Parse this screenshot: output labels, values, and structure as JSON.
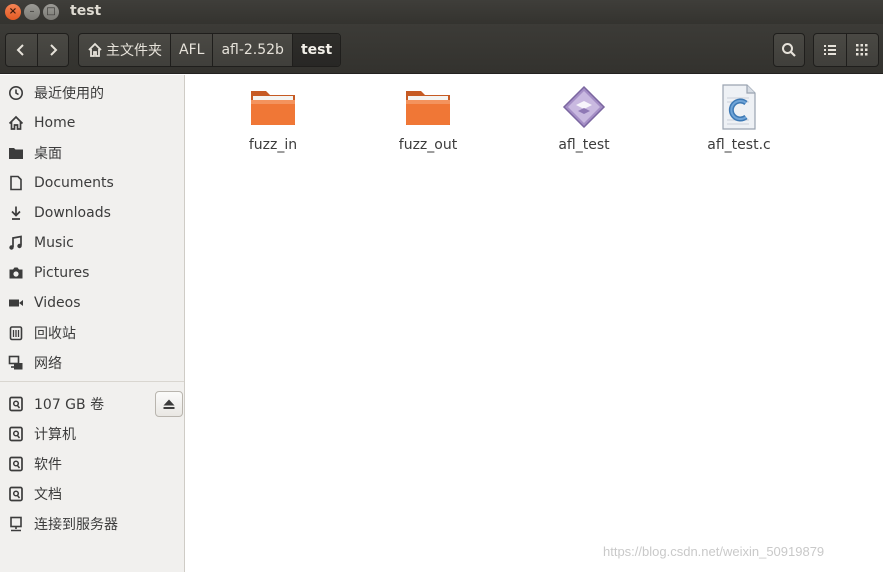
{
  "window": {
    "title": "test",
    "close_glyph": "×",
    "minimize_glyph": "–",
    "maximize_glyph": "□"
  },
  "toolbar": {
    "back_icon": "chevron-left-icon",
    "forward_icon": "chevron-right-icon",
    "breadcrumbs": [
      {
        "label": "主文件夹",
        "icon": "home-icon"
      },
      {
        "label": "AFL"
      },
      {
        "label": "afl-2.52b"
      },
      {
        "label": "test",
        "active": true
      }
    ],
    "search_icon": "search-icon",
    "list_view_icon": "list-view-icon",
    "grid_view_icon": "grid-view-icon"
  },
  "sidebar": {
    "places": [
      {
        "label": "最近使用的",
        "icon": "clock-icon"
      },
      {
        "label": "Home",
        "icon": "home-icon"
      },
      {
        "label": "桌面",
        "icon": "folder-icon"
      },
      {
        "label": "Documents",
        "icon": "document-icon"
      },
      {
        "label": "Downloads",
        "icon": "download-icon"
      },
      {
        "label": "Music",
        "icon": "music-icon"
      },
      {
        "label": "Pictures",
        "icon": "camera-icon"
      },
      {
        "label": "Videos",
        "icon": "video-icon"
      },
      {
        "label": "回收站",
        "icon": "trash-icon"
      },
      {
        "label": "网络",
        "icon": "network-icon"
      }
    ],
    "devices": [
      {
        "label": "107 GB 卷",
        "icon": "drive-icon"
      },
      {
        "label": "计算机",
        "icon": "drive-icon"
      },
      {
        "label": "软件",
        "icon": "drive-icon"
      },
      {
        "label": "文档",
        "icon": "drive-icon"
      },
      {
        "label": "连接到服务器",
        "icon": "server-icon"
      }
    ],
    "eject_icon": "eject-icon"
  },
  "files": [
    {
      "name": "fuzz_in",
      "icon": "folder-icon"
    },
    {
      "name": "fuzz_out",
      "icon": "folder-icon"
    },
    {
      "name": "afl_test",
      "icon": "executable-icon"
    },
    {
      "name": "afl_test.c",
      "icon": "c-source-icon"
    }
  ],
  "watermark": "https://blog.csdn.net/weixin_50919879",
  "colors": {
    "titlebar": "#3c3b37",
    "close_button": "#e95420",
    "folder": "#f07736",
    "sidebar_bg": "#f1f0ee"
  }
}
